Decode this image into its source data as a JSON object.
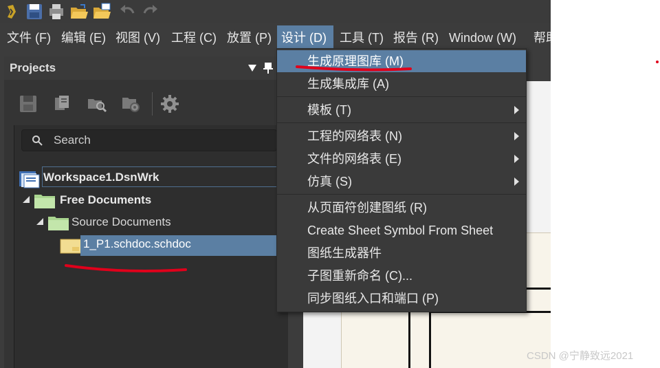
{
  "menubar": {
    "items": [
      {
        "label": "文件 (F)"
      },
      {
        "label": "编辑 (E)"
      },
      {
        "label": "视图 (V)"
      },
      {
        "label": "工程 (C)"
      },
      {
        "label": "放置 (P)"
      },
      {
        "label": "设计 (D)"
      },
      {
        "label": "工具 (T)"
      },
      {
        "label": "报告 (R)"
      },
      {
        "label": "Window (W)"
      },
      {
        "label": "帮助"
      }
    ]
  },
  "projects_panel": {
    "title": "Projects",
    "search_placeholder": "Search",
    "tree": {
      "workspace": "Workspace1.DsnWrk",
      "free_documents": "Free Documents",
      "source_documents": "Source Documents",
      "file": "1_P1.schdoc.schdoc"
    }
  },
  "design_menu": {
    "items": [
      {
        "label": "生成原理图库 (M)"
      },
      {
        "label": "生成集成库 (A)"
      },
      {
        "label": "模板 (T)"
      },
      {
        "label": "工程的网络表 (N)"
      },
      {
        "label": "文件的网络表 (E)"
      },
      {
        "label": "仿真 (S)"
      },
      {
        "label": "从页面符创建图纸 (R)"
      },
      {
        "label": "Create Sheet Symbol From Sheet"
      },
      {
        "label": "图纸生成器件"
      },
      {
        "label": "子图重新命名 (C)..."
      },
      {
        "label": "同步图纸入口和端口 (P)"
      }
    ]
  },
  "watermark": "CSDN @宁静致远2021",
  "colors": {
    "highlight": "#5b7fa3",
    "annotation": "#e0001b",
    "background": "#3c3c3c"
  },
  "icons": [
    "app-logo-icon",
    "save-icon",
    "save-all-icon",
    "open-folder-icon",
    "open-project-icon",
    "undo-icon",
    "redo-icon",
    "gear-icon",
    "search-icon",
    "pin-icon"
  ]
}
